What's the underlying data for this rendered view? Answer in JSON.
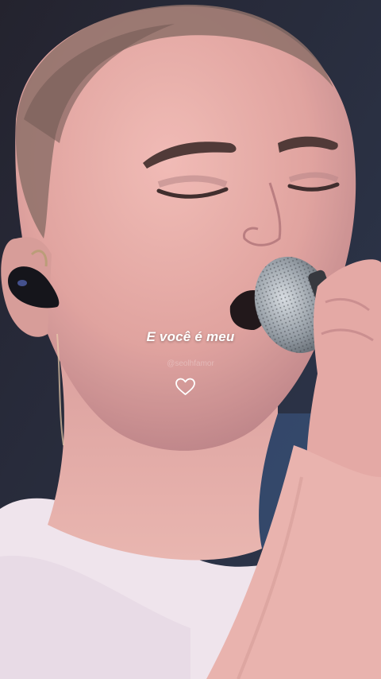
{
  "story": {
    "lyric": "E você é meu",
    "handle": "@seolhfamor",
    "heart_icon": "heart-outline-icon"
  },
  "colors": {
    "skin": "#e6a8a4",
    "shirt": "#f2e6ee",
    "background": "#1f2232",
    "caption": "#ffffff"
  }
}
